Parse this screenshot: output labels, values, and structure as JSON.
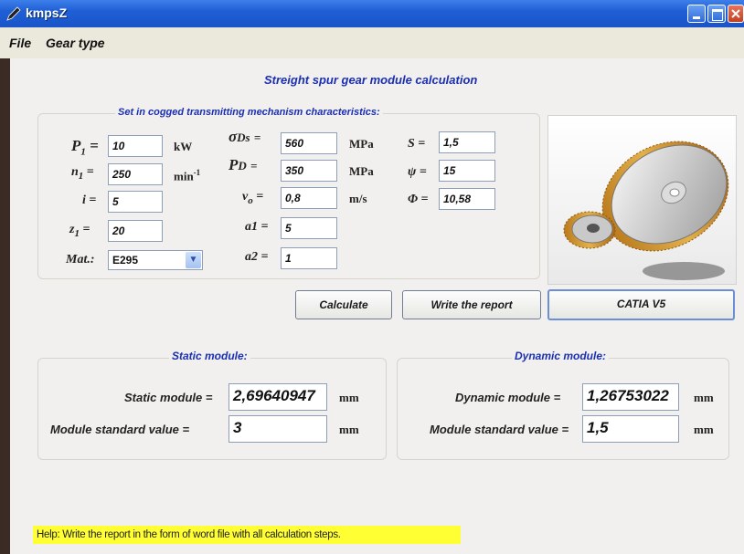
{
  "window": {
    "title": "kmpsZ"
  },
  "menu": {
    "file": "File",
    "gear_type": "Gear type"
  },
  "main": {
    "title": "Streight spur gear module calculation",
    "set_heading": "Set in cogged transmitting mechanism characteristics:"
  },
  "params": {
    "p1": {
      "label": "P",
      "sub": "1",
      "eq": "=",
      "value": "10",
      "unit": "kW"
    },
    "n1": {
      "label": "n",
      "sub": "1",
      "eq": "=",
      "value": "250",
      "unit": "min",
      "unit_sup": "-1"
    },
    "i": {
      "label": "i =",
      "value": "5"
    },
    "z1": {
      "label": "z",
      "sub": "1",
      "eq": "=",
      "value": "20"
    },
    "mat": {
      "label": "Mat.:",
      "value": "E295"
    },
    "sigma_ds": {
      "label": "σ",
      "sub": "Ds",
      "eq": "=",
      "value": "560",
      "unit": "MPa"
    },
    "p_d": {
      "label": "P",
      "sub": "D",
      "eq": "=",
      "value": "350",
      "unit": "MPa"
    },
    "v_o": {
      "label": "v",
      "sub": "o",
      "eq": "=",
      "value": "0,8",
      "unit": "m/s"
    },
    "a1": {
      "label": "a1 =",
      "value": "5"
    },
    "a2": {
      "label": "a2 =",
      "value": "1"
    },
    "s": {
      "label": "S =",
      "value": "1,5"
    },
    "psi": {
      "label": "ψ =",
      "value": "15"
    },
    "phi": {
      "label": "Φ =",
      "value": "10,58"
    }
  },
  "buttons": {
    "calculate": "Calculate",
    "report": "Write the report",
    "catia": "CATIA V5"
  },
  "static": {
    "heading": "Static module:",
    "module_label": "Static module =",
    "module_value": "2,69640947",
    "std_label": "Module standard value =",
    "std_value": "3",
    "unit": "mm"
  },
  "dynamic": {
    "heading": "Dynamic module:",
    "module_label": "Dynamic module =",
    "module_value": "1,26753022",
    "std_label": "Module standard value =",
    "std_value": "1,5",
    "unit": "mm"
  },
  "help": {
    "text": "Help: Write the report in the form of word file with all calculation steps."
  },
  "icons": {
    "app": "pen-icon",
    "gear": "spur-gear-image"
  }
}
